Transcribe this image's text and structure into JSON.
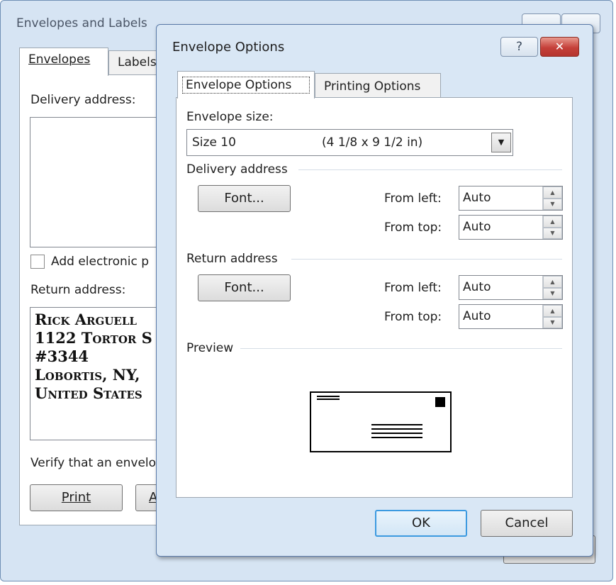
{
  "background_dialog": {
    "title": "Envelopes and Labels",
    "tabs": [
      "Envelopes",
      "Labels"
    ],
    "delivery_address_label": "Delivery address:",
    "add_electronic_label": "Add electronic p",
    "return_address_label": "Return address:",
    "return_address_lines": [
      "Rick Arguell",
      "1122 Tortor S",
      "#3344",
      "Lobortis, NY, ",
      "United States"
    ],
    "verify_text": "Verify that an envelo",
    "print_button": "Print",
    "add_button_partial": "A"
  },
  "dialog": {
    "title": "Envelope Options",
    "help_glyph": "?",
    "close_glyph": "✕",
    "tabs": [
      "Envelope Options",
      "Printing Options"
    ],
    "envelope_size_label": "Envelope size:",
    "envelope_size_value": "Size 10",
    "envelope_size_dims": "(4 1/8 x 9 1/2 in)",
    "delivery_group": "Delivery address",
    "delivery_font_button": "Font...",
    "delivery_from_left_label": "From left:",
    "delivery_from_left_value": "Auto",
    "delivery_from_top_label": "From top:",
    "delivery_from_top_value": "Auto",
    "return_group": "Return address",
    "return_font_button": "Font...",
    "return_from_left_label": "From left:",
    "return_from_left_value": "Auto",
    "return_from_top_label": "From top:",
    "return_from_top_value": "Auto",
    "preview_group": "Preview",
    "ok_button": "OK",
    "cancel_button": "Cancel"
  },
  "colors": {
    "close_red": "#c75050",
    "frame_blue": "#d9e7f5",
    "ok_focus": "#3c9ae0"
  }
}
